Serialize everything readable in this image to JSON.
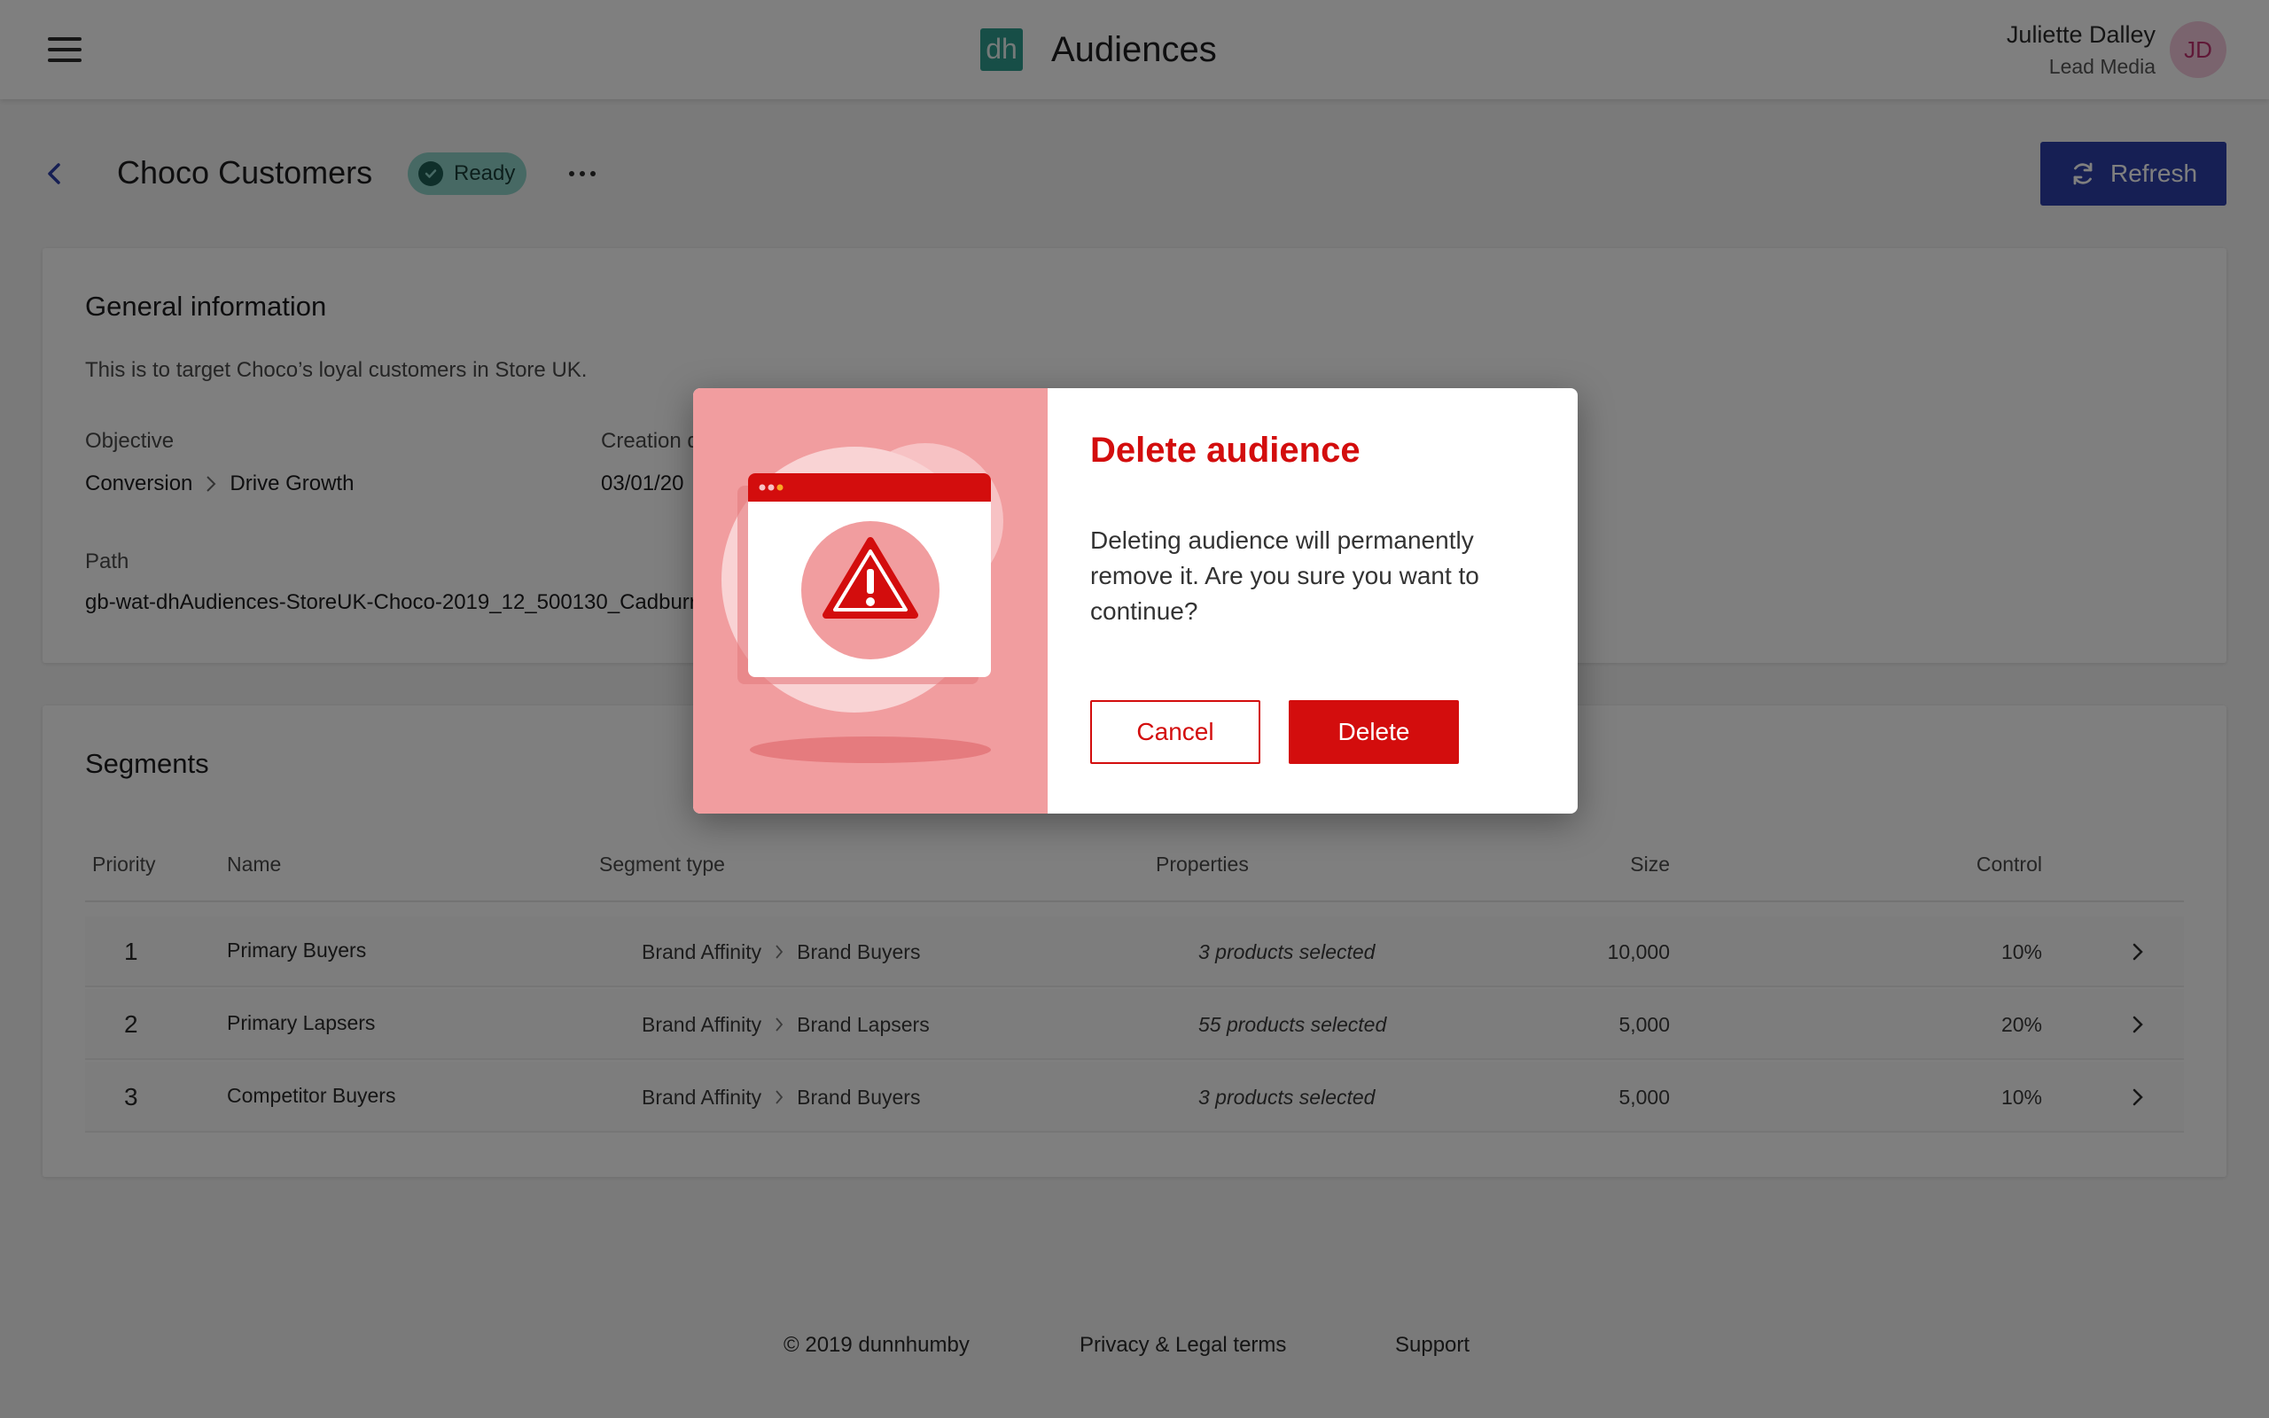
{
  "header": {
    "logo_text": "dh",
    "app_title": "Audiences",
    "user_name": "Juliette Dalley",
    "user_role": "Lead Media",
    "avatar_initials": "JD"
  },
  "page": {
    "title": "Choco Customers",
    "status": "Ready",
    "refresh_label": "Refresh"
  },
  "general": {
    "title": "General information",
    "description": "This is to target Choco’s loyal customers in Store UK.",
    "objective_label": "Objective",
    "objective_primary": "Conversion",
    "objective_secondary": "Drive Growth",
    "creation_label": "Creation d",
    "creation_value": "03/01/20",
    "path_label": "Path",
    "path_value": "gb-wat-dhAudiences-StoreUK-Choco-2019_12_500130_Cadburr"
  },
  "segments": {
    "title": "Segments",
    "columns": {
      "priority": "Priority",
      "name": "Name",
      "type": "Segment type",
      "properties": "Properties",
      "size": "Size",
      "control": "Control"
    },
    "rows": [
      {
        "priority": "1",
        "name": "Primary Buyers",
        "type_a": "Brand Affinity",
        "type_b": "Brand Buyers",
        "properties": "3 products selected",
        "size": "10,000",
        "control": "10%"
      },
      {
        "priority": "2",
        "name": "Primary Lapsers",
        "type_a": "Brand Affinity",
        "type_b": "Brand Lapsers",
        "properties": "55 products selected",
        "size": "5,000",
        "control": "20%"
      },
      {
        "priority": "3",
        "name": "Competitor Buyers",
        "type_a": "Brand Affinity",
        "type_b": "Brand Buyers",
        "properties": "3 products selected",
        "size": "5,000",
        "control": "10%"
      }
    ]
  },
  "footer": {
    "copyright": "© 2019 dunnhumby",
    "privacy": "Privacy & Legal terms",
    "support": "Support"
  },
  "modal": {
    "title": "Delete audience",
    "message": "Deleting audience will permanently remove it. Are you sure you want to continue?",
    "cancel_label": "Cancel",
    "delete_label": "Delete",
    "illustration_icon": "warning-icon"
  },
  "colors": {
    "accent_red": "#d30d0d",
    "primary_blue": "#2d3fa8",
    "ready_green": "#8fd3c8",
    "logo_teal": "#2e9c8e"
  }
}
